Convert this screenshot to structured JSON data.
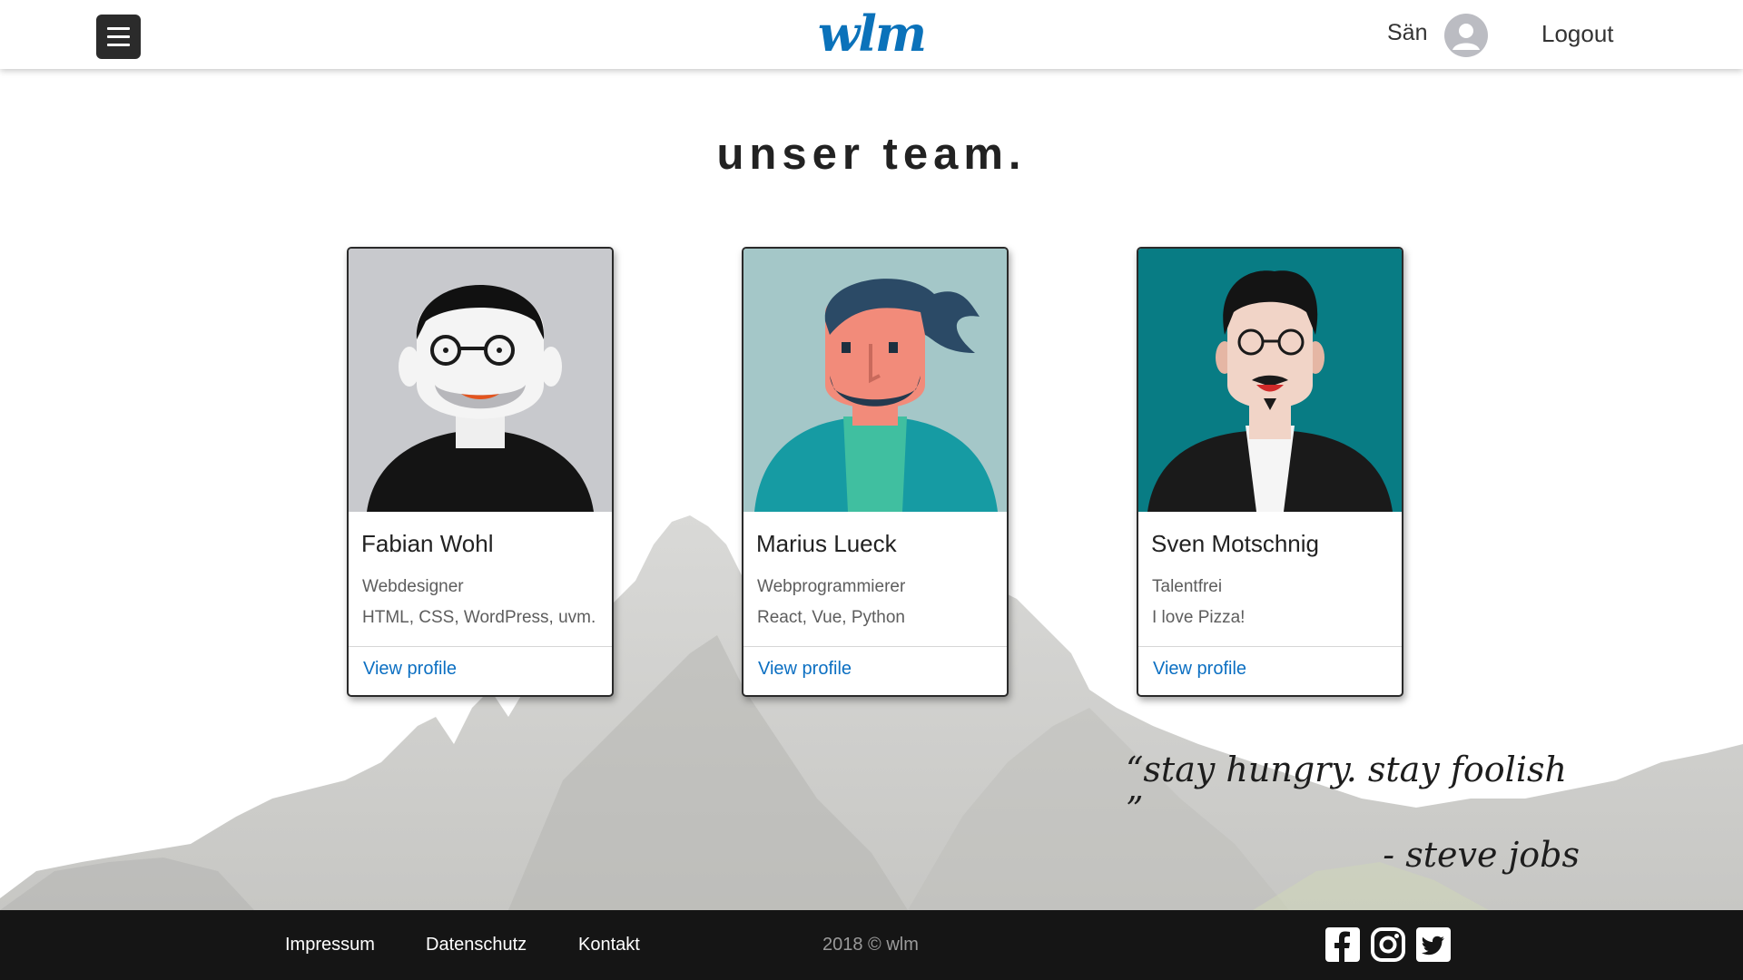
{
  "header": {
    "logo": "wlm",
    "user_name": "Sän",
    "logout_label": "Logout"
  },
  "page": {
    "title": "unser team."
  },
  "team": [
    {
      "name": "Fabian Wohl",
      "role": "Webdesigner",
      "skills": "HTML, CSS, WordPress, uvm.",
      "link": "View profile",
      "bg_color": "#c8c9cd"
    },
    {
      "name": "Marius Lueck",
      "role": "Webprogrammierer",
      "skills": "React, Vue, Python",
      "link": "View profile",
      "bg_color": "#a4c7c8"
    },
    {
      "name": "Sven Motschnig",
      "role": "Talentfrei",
      "skills": "I love Pizza!",
      "link": "View profile",
      "bg_color": "#087c84"
    }
  ],
  "quote": {
    "line1": "“stay hungry. stay foolish ”",
    "line2": "- steve jobs"
  },
  "footer": {
    "links": [
      "Impressum",
      "Datenschutz",
      "Kontakt"
    ],
    "copyright": "2018 © wlm",
    "social_icons": [
      "facebook-icon",
      "instagram-icon",
      "twitter-icon"
    ]
  },
  "colors": {
    "brand": "#0b72ba",
    "link": "#0b6fc2",
    "footer_bg": "#151515"
  }
}
